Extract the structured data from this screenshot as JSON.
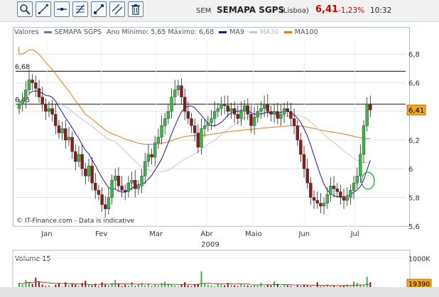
{
  "toolbar": {
    "buttons": [
      {
        "name": "zoom-icon"
      },
      {
        "name": "line-draw-icon"
      },
      {
        "name": "horizontal-line-icon"
      },
      {
        "name": "indicator-icon"
      },
      {
        "name": "expand-icon"
      },
      {
        "name": "parallel-lines-icon"
      },
      {
        "name": "trash-icon"
      }
    ]
  },
  "ticker": {
    "exchange": "SEM",
    "name": "SEMAPA SGPS",
    "market": "(Lisboa)",
    "price": "6,41",
    "change": "-1,23%",
    "time": "10:32"
  },
  "colors": {
    "up": "#39b54a",
    "down": "#8b1a1a",
    "ma9": "#1a1a8c",
    "ma30": "#c8c8c8",
    "ma100": "#e07b1a",
    "price_tag": "#f5a623",
    "price_negative": "#cc0000"
  },
  "legend": {
    "title": "Valores",
    "series": "SEMAPA SGPS",
    "range_text": "Ano Mínimo: 5,65 Máximo: 6,68",
    "ma9": "MA9",
    "ma30": "MA30",
    "ma100": "MA100"
  },
  "chart_data": [
    {
      "type": "candlestick",
      "title": "",
      "xlabel": "2009",
      "ylabel": "",
      "x_tick_labels": [
        "Jan",
        "Fev",
        "Mar",
        "Abr",
        "Maio",
        "Jun",
        "Jul"
      ],
      "y_ticks": [
        5.6,
        5.8,
        6.0,
        6.2,
        6.4,
        6.6,
        6.8
      ],
      "y_tick_labels": [
        "5,6",
        "5,8",
        "6",
        "6,2",
        "6,4",
        "6,6",
        "6,8"
      ],
      "ylim": [
        5.6,
        6.9
      ],
      "reference_lines": [
        {
          "value": 6.68,
          "label": "6,68"
        },
        {
          "value": 6.45,
          "label": "6,45"
        }
      ],
      "last_price": {
        "value": 6.41,
        "label": "6,41"
      },
      "annotation": "© IT-Finance.com - Data is indicative",
      "close": [
        6.45,
        6.48,
        6.55,
        6.62,
        6.6,
        6.56,
        6.5,
        6.45,
        6.4,
        6.42,
        6.38,
        6.3,
        6.25,
        6.28,
        6.2,
        6.22,
        6.12,
        6.05,
        6.1,
        6.0,
        5.95,
        6.02,
        5.9,
        5.85,
        5.82,
        5.75,
        5.72,
        5.8,
        5.92,
        5.95,
        5.88,
        5.85,
        5.84,
        5.9,
        5.92,
        5.86,
        5.88,
        5.95,
        6.05,
        6.1,
        6.08,
        6.18,
        6.22,
        6.3,
        6.35,
        6.4,
        6.5,
        6.55,
        6.58,
        6.5,
        6.4,
        6.35,
        6.3,
        6.25,
        6.15,
        6.28,
        6.3,
        6.32,
        6.35,
        6.4,
        6.42,
        6.45,
        6.44,
        6.4,
        6.42,
        6.38,
        6.35,
        6.4,
        6.44,
        6.38,
        6.3,
        6.36,
        6.4,
        6.42,
        6.45,
        6.4,
        6.38,
        6.4,
        6.35,
        6.38,
        6.42,
        6.4,
        6.35,
        6.3,
        6.2,
        6.1,
        6.0,
        5.9,
        5.8,
        5.78,
        5.76,
        5.74,
        5.76,
        5.82,
        5.88,
        5.86,
        5.84,
        5.8,
        5.78,
        5.8,
        5.85,
        5.9,
        5.95,
        6.1,
        6.3,
        6.45,
        6.41
      ],
      "volume": {
        "title": "Volume 15",
        "y_tick_label": "1000K",
        "last_value": "19390",
        "values": [
          80,
          60,
          120,
          90,
          70,
          150,
          100,
          60,
          40,
          50,
          30,
          60,
          80,
          40,
          90,
          50,
          70,
          60,
          40,
          80,
          110,
          60,
          50,
          70,
          40,
          90,
          60,
          50,
          80,
          120,
          70,
          40,
          60,
          50,
          90,
          40,
          60,
          80,
          50,
          70,
          40,
          60,
          50,
          80,
          100,
          70,
          60,
          50,
          40,
          60,
          90,
          50,
          40,
          60,
          70,
          230,
          80,
          60,
          50,
          40,
          70,
          60,
          50,
          80,
          60,
          50,
          40,
          70,
          60,
          50,
          40,
          60,
          50,
          80,
          40,
          60,
          50,
          100,
          70,
          40,
          60,
          50,
          40,
          30,
          50,
          40,
          60,
          50,
          40,
          30,
          90,
          40,
          50,
          60,
          40,
          50,
          30,
          40,
          50,
          60,
          40,
          100,
          80,
          60,
          50,
          160,
          90
        ]
      }
    }
  ]
}
